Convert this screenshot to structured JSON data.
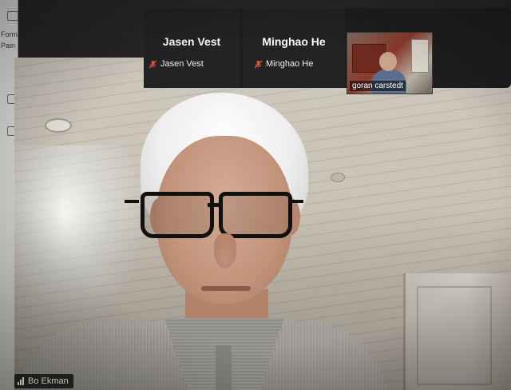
{
  "app": {
    "left_strip_labels": [
      "Form",
      "Pain"
    ]
  },
  "participants": [
    {
      "display_name": "Jasen Vest",
      "label": "Jasen Vest",
      "mic": "muted"
    },
    {
      "display_name": "Minghao He",
      "label": "Minghao He",
      "mic": "muted"
    },
    {
      "label": "goran carstedt",
      "video": "on"
    }
  ],
  "main_speaker": {
    "label": "Bo Ekman",
    "connection_icon": "signal-bars-icon"
  },
  "colors": {
    "mute_icon": "#e0523e",
    "tile_background": "#232323",
    "label_text": "#ffffff"
  }
}
